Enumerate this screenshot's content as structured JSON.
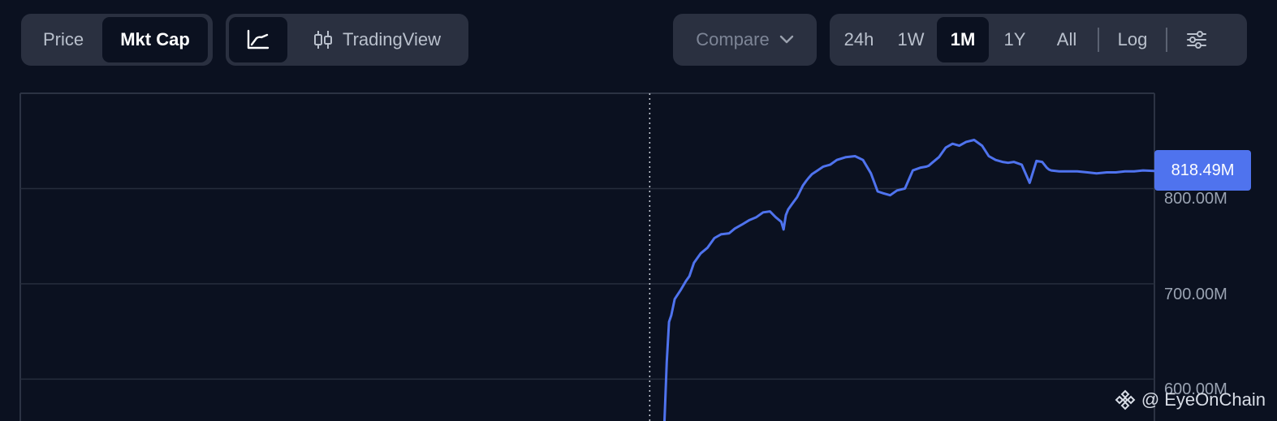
{
  "toolbar": {
    "type_group": {
      "price": "Price",
      "mkt_cap": "Mkt Cap",
      "active": "mkt_cap"
    },
    "view_group": {
      "tradingview": "TradingView",
      "active": "line"
    },
    "compare": {
      "label": "Compare"
    },
    "ranges": [
      "24h",
      "1W",
      "1M",
      "1Y",
      "All"
    ],
    "active_range": "1M",
    "log": "Log"
  },
  "colors": {
    "background": "#0b1120",
    "line": "#4f73ee",
    "grid": "#262d3c",
    "button_bg": "#2a3040",
    "badge_bg": "#4f73ee"
  },
  "icons": {
    "view": [
      "line-chart-icon",
      "candlestick-icon"
    ],
    "compare": "chevron-down-icon",
    "settings": "sliders-icon",
    "watermark": "binance-logo-icon"
  },
  "chart_data": {
    "type": "line",
    "title": "",
    "xlabel": "",
    "ylabel": "",
    "y_ticks": [
      "800.00M",
      "700.00M",
      "600.00M"
    ],
    "y_tick_values": [
      800,
      700,
      600
    ],
    "ylim": [
      556,
      900
    ],
    "xlim": [
      0,
      100
    ],
    "grid": true,
    "crosshair_x": 55.5,
    "last_value_label": "818.49M",
    "series": [
      {
        "x": [
          56.8,
          57.0,
          57.2,
          57.4,
          57.7,
          58.2,
          58.7,
          59.0,
          59.4,
          60.0,
          60.6,
          61.2,
          61.8,
          62.5,
          63.0,
          63.6,
          64.3,
          64.9,
          65.5,
          66.1,
          66.6,
          67.1,
          67.3,
          67.5,
          67.7,
          68.0,
          68.5,
          69.0,
          69.3,
          69.5,
          69.8,
          70.3,
          70.8,
          71.4,
          72.0,
          72.8,
          73.6,
          74.3,
          75.0,
          75.6,
          76.1,
          76.7,
          77.3,
          78.0,
          78.7,
          79.4,
          79.9,
          80.1,
          80.4,
          81.0,
          81.6,
          82.2,
          82.8,
          83.4,
          84.1,
          84.8,
          85.4,
          86.0,
          86.6,
          87.1,
          87.6,
          88.3,
          89.0,
          89.6,
          90.1,
          90.5,
          90.7,
          90.9,
          91.6,
          92.4,
          93.2,
          94.1,
          94.9,
          95.8,
          96.6,
          97.4,
          98.2,
          99.0,
          100.0
        ],
        "values": [
          556,
          618,
          660,
          667,
          684,
          693,
          703,
          708,
          722,
          732,
          738,
          748,
          752,
          753,
          758,
          762,
          767,
          770,
          775,
          776,
          770,
          765,
          757,
          772,
          778,
          783,
          791,
          803,
          808,
          811,
          815,
          819,
          823,
          825,
          830,
          833,
          834,
          830,
          816,
          797,
          795,
          793,
          798,
          800,
          819,
          822,
          823,
          824,
          827,
          833,
          843,
          847,
          845,
          849,
          851,
          845,
          834,
          830,
          828,
          827,
          828,
          825,
          806,
          829,
          828,
          822,
          820,
          819,
          818,
          818,
          818,
          817,
          816,
          817,
          817,
          818,
          818,
          819,
          818.49
        ]
      }
    ]
  },
  "watermark": "@ EyeOnChain"
}
